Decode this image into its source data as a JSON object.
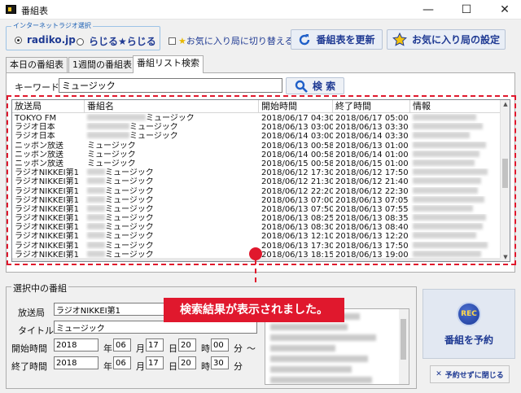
{
  "window": {
    "title": "番組表",
    "min": "—",
    "max": "☐",
    "close": "✕"
  },
  "source_group": {
    "title": "インターネットラジオ選択",
    "options": [
      {
        "label": "radiko.jp",
        "selected": true
      },
      {
        "label": "らじる★らじる",
        "selected": false
      }
    ]
  },
  "favorites_toggle": {
    "label": "お気に入り局に切り替える",
    "checked": false
  },
  "buttons": {
    "refresh": "番組表を更新",
    "favorites_settings": "お気に入り局の設定"
  },
  "tabs": [
    {
      "label": "本日の番組表",
      "active": false
    },
    {
      "label": "1週間の番組表",
      "active": false
    },
    {
      "label": "番組リスト検索",
      "active": true
    }
  ],
  "search": {
    "label": "キーワード",
    "value": "ミュージック",
    "button": "検 索"
  },
  "results": {
    "columns": [
      "放送局",
      "番組名",
      "開始時間",
      "終了時間",
      "情報"
    ],
    "rows": [
      {
        "station": "TOKYO FM",
        "title": "ミュージック",
        "start": "2018/06/17 04:30",
        "end": "2018/06/17 05:00"
      },
      {
        "station": "ラジオ日本",
        "title": "ミュージック",
        "start": "2018/06/13 03:00",
        "end": "2018/06/13 03:30"
      },
      {
        "station": "ラジオ日本",
        "title": "ミュージック",
        "start": "2018/06/14 03:00",
        "end": "2018/06/14 03:30"
      },
      {
        "station": "ニッポン放送",
        "title": "ミュージック",
        "start": "2018/06/13 00:58",
        "end": "2018/06/13 01:00"
      },
      {
        "station": "ニッポン放送",
        "title": "ミュージック",
        "start": "2018/06/14 00:58",
        "end": "2018/06/14 01:00"
      },
      {
        "station": "ニッポン放送",
        "title": "ミュージック",
        "start": "2018/06/15 00:58",
        "end": "2018/06/15 01:00"
      },
      {
        "station": "ラジオNIKKEI第1",
        "title": "ミュージック",
        "start": "2018/06/12 17:30",
        "end": "2018/06/12 17:50"
      },
      {
        "station": "ラジオNIKKEI第1",
        "title": "ミュージック",
        "start": "2018/06/12 21:30",
        "end": "2018/06/12 21:40"
      },
      {
        "station": "ラジオNIKKEI第1",
        "title": "ミュージック",
        "start": "2018/06/12 22:20",
        "end": "2018/06/12 22:30"
      },
      {
        "station": "ラジオNIKKEI第1",
        "title": "ミュージック",
        "start": "2018/06/13 07:00",
        "end": "2018/06/13 07:05"
      },
      {
        "station": "ラジオNIKKEI第1",
        "title": "ミュージック",
        "start": "2018/06/13 07:50",
        "end": "2018/06/13 07:55"
      },
      {
        "station": "ラジオNIKKEI第1",
        "title": "ミュージック",
        "start": "2018/06/13 08:25",
        "end": "2018/06/13 08:35"
      },
      {
        "station": "ラジオNIKKEI第1",
        "title": "ミュージック",
        "start": "2018/06/13 08:30",
        "end": "2018/06/13 08:40"
      },
      {
        "station": "ラジオNIKKEI第1",
        "title": "ミュージック",
        "start": "2018/06/13 12:10",
        "end": "2018/06/13 12:20"
      },
      {
        "station": "ラジオNIKKEI第1",
        "title": "ミュージック",
        "start": "2018/06/13 17:30",
        "end": "2018/06/13 17:50"
      },
      {
        "station": "ラジオNIKKEI第1",
        "title": "ミュージック",
        "start": "2018/06/13 18:15",
        "end": "2018/06/13 19:00"
      }
    ]
  },
  "callout": "検索結果が表示されました。",
  "selected": {
    "title": "選択中の番組",
    "station_label": "放送局",
    "station": "ラジオNIKKEI第1",
    "program_label": "タイトル",
    "program": "ミュージック",
    "start_label": "開始時間",
    "start": {
      "year": "2018",
      "month": "06",
      "day": "17",
      "hour": "20",
      "minute": "00"
    },
    "end_label": "終了時間",
    "end": {
      "year": "2018",
      "month": "06",
      "day": "17",
      "hour": "20",
      "minute": "30"
    },
    "units": {
      "year": "年",
      "month": "月",
      "day": "日",
      "hour": "時",
      "minute": "分",
      "range": "〜"
    }
  },
  "actions": {
    "rec_badge": "REC",
    "record": "番組を予約",
    "close": "予約せずに閉じる"
  }
}
